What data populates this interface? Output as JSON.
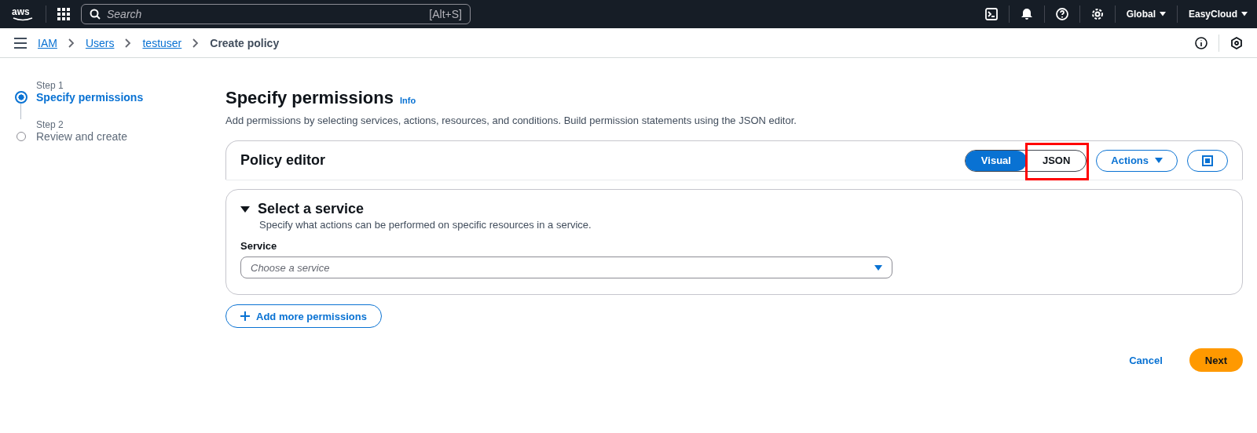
{
  "top_bar": {
    "logo": "aws",
    "search": {
      "placeholder": "Search",
      "shortcut": "[Alt+S]"
    },
    "region": "Global",
    "account": "EasyCloud"
  },
  "breadcrumbs": [
    {
      "label": "IAM",
      "link": true
    },
    {
      "label": "Users",
      "link": true
    },
    {
      "label": "testuser",
      "link": true
    },
    {
      "label": "Create policy",
      "link": false
    }
  ],
  "steps": [
    {
      "step": "Step 1",
      "label": "Specify permissions",
      "selected": true
    },
    {
      "step": "Step 2",
      "label": "Review and create",
      "selected": false
    }
  ],
  "page": {
    "title": "Specify permissions",
    "info": "Info",
    "description": "Add permissions by selecting services, actions, resources, and conditions. Build permission statements using the JSON editor."
  },
  "policy_editor": {
    "title": "Policy editor",
    "modes": [
      {
        "label": "Visual",
        "selected": true,
        "highlighted": false
      },
      {
        "label": "JSON",
        "selected": false,
        "highlighted": true
      }
    ],
    "actions": "Actions"
  },
  "service_section": {
    "title": "Select a service",
    "expanded": true,
    "description": "Specify what actions can be performed on specific resources in a service.",
    "field_label": "Service",
    "placeholder": "Choose a service"
  },
  "add_button": "Add more permissions",
  "footer": {
    "cancel": "Cancel",
    "next": "Next"
  }
}
